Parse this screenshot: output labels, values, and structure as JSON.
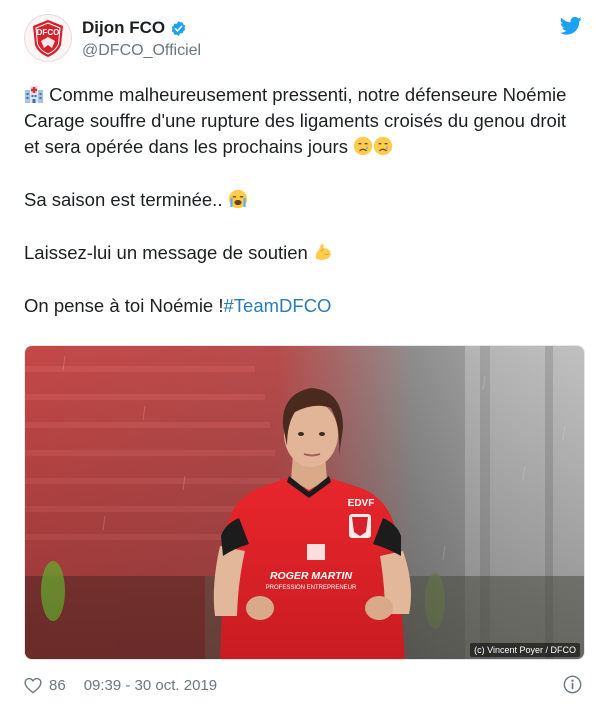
{
  "tweet": {
    "author": {
      "display_name": "Dijon FCO",
      "handle": "@DFCO_Officiel",
      "avatar_text": "DFCO"
    },
    "text": {
      "line1": "Comme malheureusement pressenti, notre défenseure Noémie Carage souffre d'une rupture des ligaments croisés du genou droit et sera opérée dans les prochains jours ",
      "line2": "Sa saison est terminée.. ",
      "line3": "Laissez-lui un message de soutien ",
      "line4_prefix": "On pense à toi Noémie !",
      "hashtag": "#TeamDFCO"
    },
    "photo": {
      "credit": "(c) Vincent Poyer / DFCO",
      "jersey_sponsor": "ROGER MARTIN",
      "jersey_sponsor_sub": "PROFESSION ENTREPRENEUR",
      "jersey_brand": "EDVF"
    },
    "footer": {
      "likes": "86",
      "timestamp": "09:39 - 30 oct. 2019"
    }
  },
  "colors": {
    "text": "#1c2022",
    "secondary": "#697882",
    "link": "#2b7bb9",
    "twitter_blue": "#1da1f2",
    "dfco_red": "#d6202b"
  },
  "icons": [
    "dfco-logo-icon",
    "verified-badge-icon",
    "twitter-bird-icon",
    "hospital-icon",
    "crying-face-icon",
    "loudly-crying-face-icon",
    "flexed-biceps-icon",
    "heart-icon",
    "info-icon"
  ]
}
